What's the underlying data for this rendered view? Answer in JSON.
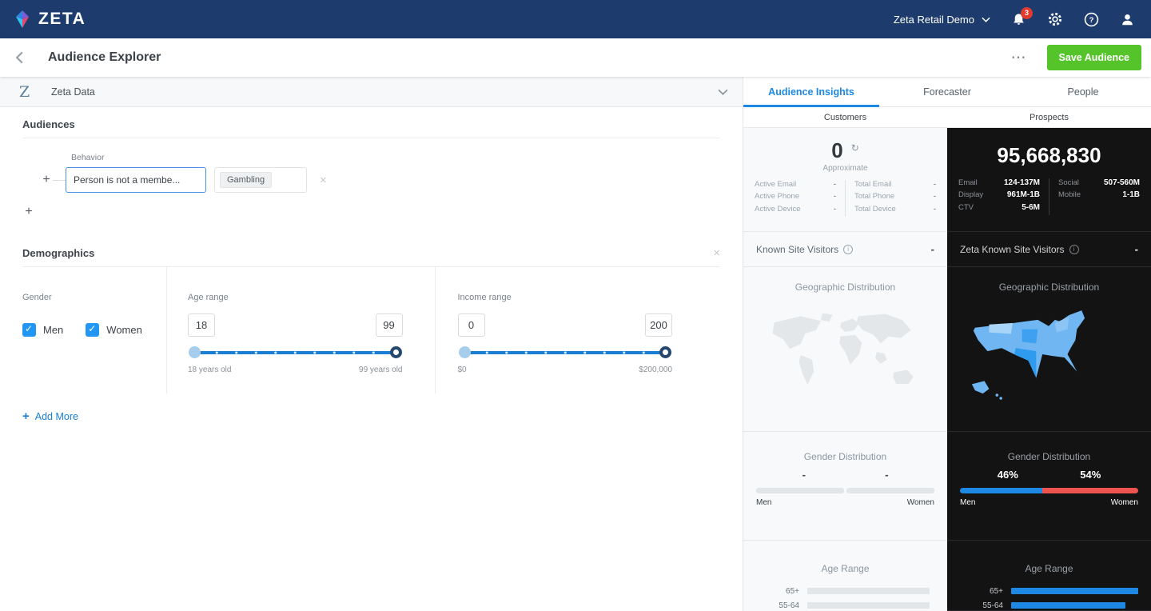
{
  "icons": {
    "ellipsis": "⋯",
    "plus": "+",
    "close": "×",
    "refresh": "↻",
    "info": "i"
  },
  "colors": {
    "topnav": "#1d3c6d",
    "accent_blue": "#1e88e5",
    "save_green": "#55c32a",
    "men_bar": "#1e88e5",
    "women_bar": "#ef5350"
  },
  "topnav": {
    "brand": "ZETA",
    "account": "Zeta Retail Demo",
    "notification_count": "3"
  },
  "page_header": {
    "title": "Audience Explorer",
    "save_button": "Save Audience"
  },
  "builder": {
    "source": {
      "logo_letter": "Z",
      "title": "Zeta Data"
    },
    "audiences_title": "Audiences",
    "behavior": {
      "label": "Behavior",
      "operator": "Person is not a membe...",
      "tag": "Gambling"
    },
    "demographics": {
      "title": "Demographics",
      "gender_label": "Gender",
      "gender_options": [
        {
          "label": "Men",
          "checked": true
        },
        {
          "label": "Women",
          "checked": true
        }
      ],
      "age": {
        "label": "Age range",
        "min": "18",
        "max": "99",
        "min_caption": "18 years old",
        "max_caption": "99 years old"
      },
      "income": {
        "label": "Income range",
        "min": "0",
        "max": "200",
        "min_caption": "$0",
        "max_caption": "$200,000"
      }
    },
    "add_more_label": "Add More"
  },
  "insights": {
    "tabs": [
      {
        "label": "Audience Insights",
        "active": true
      },
      {
        "label": "Forecaster",
        "active": false
      },
      {
        "label": "People",
        "active": false
      }
    ],
    "subtabs": [
      "Customers",
      "Prospects"
    ],
    "customers": {
      "count": "0",
      "count_caption": "Approximate",
      "stats_left": [
        {
          "label": "Active Email",
          "value": "-"
        },
        {
          "label": "Active Phone",
          "value": "-"
        },
        {
          "label": "Active Device",
          "value": "-"
        }
      ],
      "stats_right": [
        {
          "label": "Total Email",
          "value": "-"
        },
        {
          "label": "Total Phone",
          "value": "-"
        },
        {
          "label": "Total Device",
          "value": "-"
        }
      ],
      "known_site_visitors": {
        "label": "Known Site Visitors",
        "value": "-"
      },
      "geo_title": "Geographic Distribution",
      "gender": {
        "title": "Gender Distribution",
        "men_label": "Men",
        "men_value": "-",
        "women_label": "Women",
        "women_value": "-"
      },
      "age": {
        "title": "Age Range",
        "rows": [
          {
            "label": "65+",
            "pct": 96
          },
          {
            "label": "55-64",
            "pct": 96
          }
        ]
      }
    },
    "prospects": {
      "count": "95,668,830",
      "stats_left": [
        {
          "label": "Email",
          "value": "124-137M"
        },
        {
          "label": "Display",
          "value": "961M-1B"
        },
        {
          "label": "CTV",
          "value": "5-6M"
        }
      ],
      "stats_right": [
        {
          "label": "Social",
          "value": "507-560M"
        },
        {
          "label": "Mobile",
          "value": "1-1B"
        }
      ],
      "known_site_visitors": {
        "label": "Zeta Known Site Visitors",
        "value": "-"
      },
      "geo_title": "Geographic Distribution",
      "gender": {
        "title": "Gender Distribution",
        "men_label": "Men",
        "men_value": "46%",
        "men_pct": 46,
        "women_label": "Women",
        "women_value": "54%",
        "women_pct": 54
      },
      "age": {
        "title": "Age Range",
        "rows": [
          {
            "label": "65+",
            "pct": 100
          },
          {
            "label": "55-64",
            "pct": 90
          }
        ]
      }
    }
  }
}
